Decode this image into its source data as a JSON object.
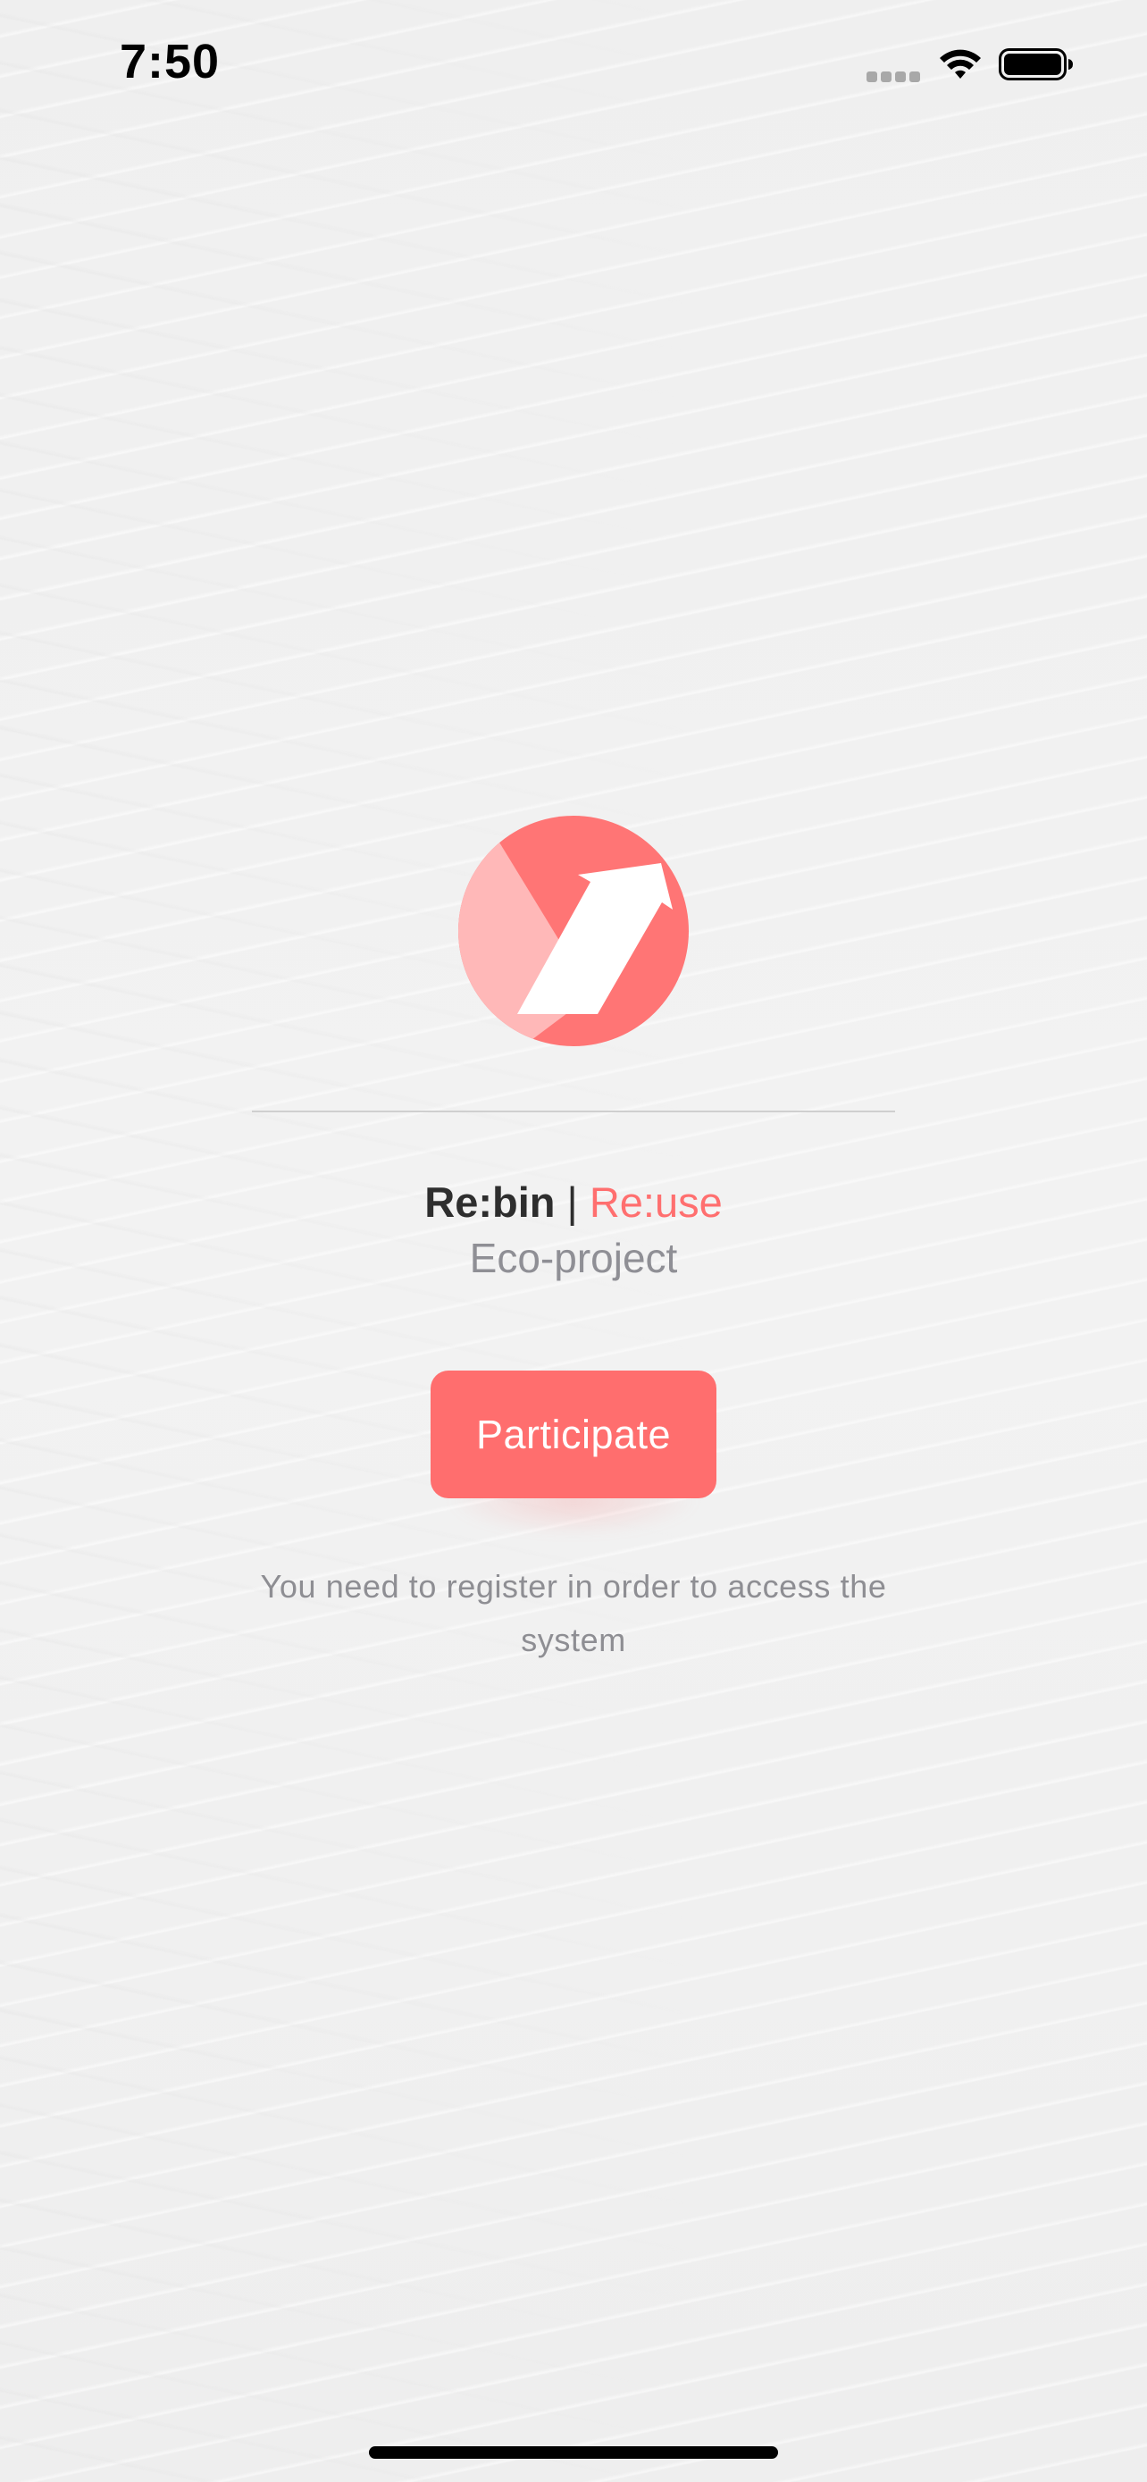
{
  "status_bar": {
    "time": "7:50",
    "icons": [
      "signal-dots-icon",
      "wifi-icon",
      "battery-icon"
    ]
  },
  "logo": {
    "icon": "rebin-logo-icon",
    "colors": {
      "circle": "#ff7575",
      "light_segment": "#ffb8b8",
      "arrow": "#ffffff"
    }
  },
  "brand": {
    "name": "Re:bin",
    "separator": "|",
    "tagline": "Re:use",
    "subtitle": "Eco-project"
  },
  "participate_button": {
    "label": "Participate"
  },
  "info": {
    "text": "You need to register in order to access the system"
  },
  "colors": {
    "accent": "#ff6e6e",
    "brand_dark": "#2e2e2e",
    "secondary_text": "#8e8e93",
    "background": "#f0f0f0"
  }
}
